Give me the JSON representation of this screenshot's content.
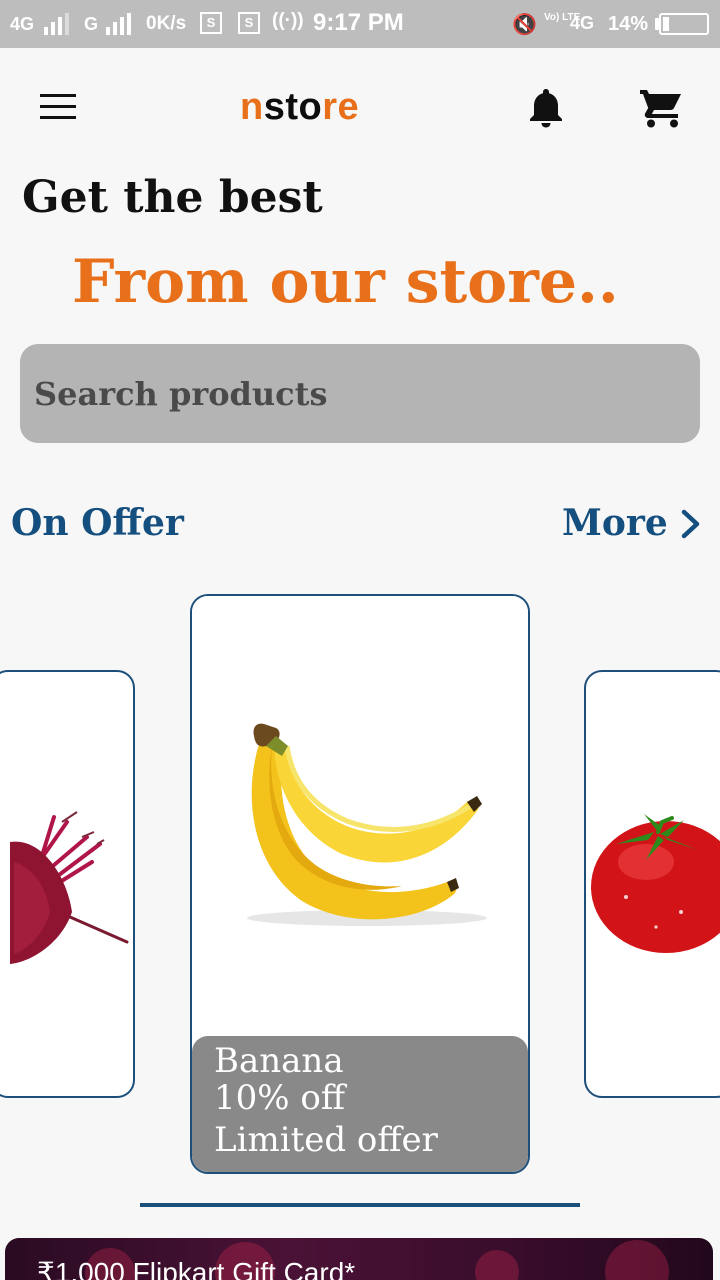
{
  "status_bar": {
    "network1": "4G",
    "network2": "G",
    "speed": "0K/s",
    "time": "9:17 PM",
    "volte": "Vo) LTE",
    "network3": "4G",
    "battery": "14%",
    "battery_level": 0.14
  },
  "app_bar": {
    "brand_prefix": "n",
    "brand_middle": "sto",
    "brand_suffix": "re"
  },
  "hero": {
    "headline": "Get the best",
    "subheadline": "From our store.."
  },
  "search": {
    "placeholder": "Search products"
  },
  "offers": {
    "section_title": "On Offer",
    "more_label": "More",
    "featured": {
      "name": "Banana",
      "discount": "10% off",
      "note": "Limited offer"
    },
    "side_items": [
      "beetroot",
      "tomato"
    ]
  },
  "banner": {
    "text": "₹1,000 Flipkart Gift Card*"
  },
  "colors": {
    "accent": "#e8701a",
    "primary": "#154f7f",
    "search_bg": "#b4b4b4",
    "caption_bg": "#898989"
  }
}
